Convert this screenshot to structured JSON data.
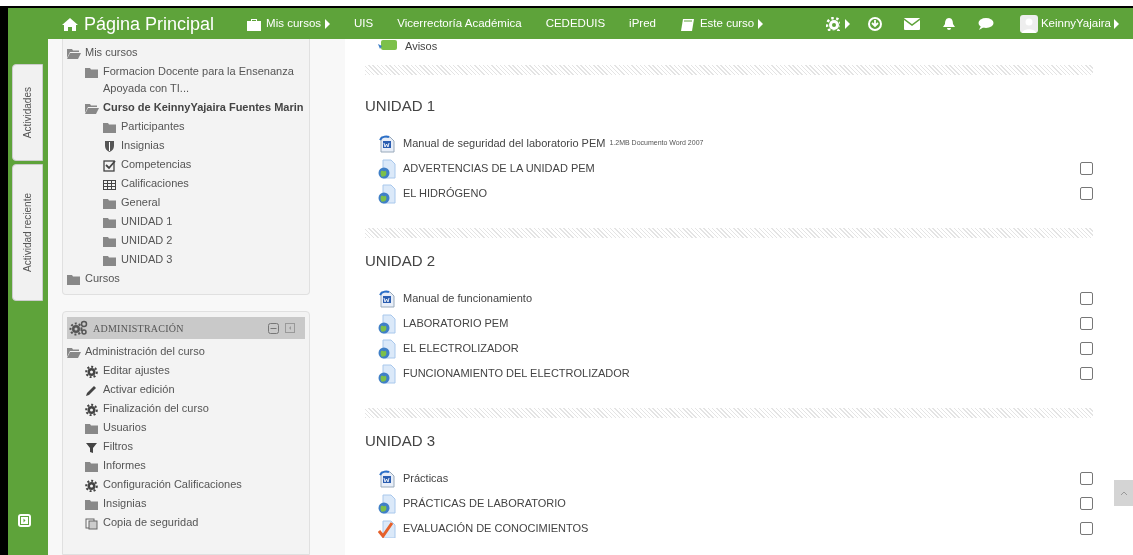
{
  "header": {
    "title": "Página Principal",
    "menu": [
      {
        "label": "Mis cursos",
        "kind": "briefcase",
        "dropdown": true
      },
      {
        "label": "UIS",
        "kind": "plain",
        "dropdown": false
      },
      {
        "label": "Vicerrectoría Académica",
        "kind": "plain",
        "dropdown": false
      },
      {
        "label": "CEDEDUIS",
        "kind": "plain",
        "dropdown": false
      },
      {
        "label": "iPred",
        "kind": "plain",
        "dropdown": false
      },
      {
        "label": "Este curso",
        "kind": "book",
        "dropdown": true
      }
    ],
    "user": {
      "name": "KeinnyYajaira"
    }
  },
  "block_tabs": [
    {
      "label": "Actividades"
    },
    {
      "label": "Actividad reciente"
    }
  ],
  "navigation": {
    "items": [
      {
        "label": "Mis cursos",
        "kind": "folder-open",
        "current": false,
        "children": [
          {
            "label": "Formacion Docente para la Ensenanza Apoyada con TI...",
            "kind": "folder",
            "current": false
          },
          {
            "label": "Curso de KeinnyYajaira Fuentes Marin",
            "kind": "folder-open",
            "current": true,
            "children": [
              {
                "label": "Participantes",
                "kind": "folder",
                "current": false
              },
              {
                "label": "Insignias",
                "kind": "shield",
                "current": false
              },
              {
                "label": "Competencias",
                "kind": "check",
                "current": false
              },
              {
                "label": "Calificaciones",
                "kind": "table",
                "current": false
              },
              {
                "label": "General",
                "kind": "folder",
                "current": false
              },
              {
                "label": "UNIDAD 1",
                "kind": "folder",
                "current": false
              },
              {
                "label": "UNIDAD 2",
                "kind": "folder",
                "current": false
              },
              {
                "label": "UNIDAD 3",
                "kind": "folder",
                "current": false
              }
            ]
          }
        ]
      },
      {
        "label": "Cursos",
        "kind": "folder",
        "current": false
      }
    ]
  },
  "administration": {
    "title": "ADMINISTRACIÓN",
    "items": [
      {
        "label": "Administración del curso",
        "kind": "folder-open",
        "children": [
          {
            "label": "Editar ajustes",
            "kind": "gear"
          },
          {
            "label": "Activar edición",
            "kind": "pencil"
          },
          {
            "label": "Finalización del curso",
            "kind": "gear"
          },
          {
            "label": "Usuarios",
            "kind": "folder"
          },
          {
            "label": "Filtros",
            "kind": "filter"
          },
          {
            "label": "Informes",
            "kind": "folder"
          },
          {
            "label": "Configuración Calificaciones",
            "kind": "gear"
          },
          {
            "label": "Insignias",
            "kind": "folder"
          },
          {
            "label": "Copia de seguridad",
            "kind": "copy"
          }
        ]
      }
    ]
  },
  "sections": [
    {
      "activities": [
        {
          "kind": "forum",
          "name": "Avisos"
        }
      ]
    },
    {
      "title": "UNIDAD 1",
      "activities": [
        {
          "kind": "word",
          "name": "Manual de seguridad del laboratorio PEM",
          "meta": "1.2MB Documento Word 2007"
        },
        {
          "kind": "url",
          "name": "ADVERTENCIAS DE LA UNIDAD PEM",
          "checked": false
        },
        {
          "kind": "url",
          "name": "EL HIDRÓGENO",
          "checked": false
        }
      ]
    },
    {
      "title": "UNIDAD 2",
      "activities": [
        {
          "kind": "word",
          "name": "Manual de funcionamiento",
          "checked": false
        },
        {
          "kind": "url",
          "name": "LABORATORIO PEM",
          "checked": false
        },
        {
          "kind": "url",
          "name": "EL ELECTROLIZADOR",
          "checked": false
        },
        {
          "kind": "url",
          "name": "FUNCIONAMIENTO DEL ELECTROLIZADOR",
          "checked": false
        }
      ]
    },
    {
      "title": "UNIDAD 3",
      "activities": [
        {
          "kind": "word",
          "name": "Prácticas",
          "checked": false
        },
        {
          "kind": "url",
          "name": "PRÁCTICAS DE LABORATORIO",
          "checked": false
        },
        {
          "kind": "quiz",
          "name": "EVALUACIÓN DE CONOCIMIENTOS",
          "checked": false
        }
      ]
    }
  ]
}
